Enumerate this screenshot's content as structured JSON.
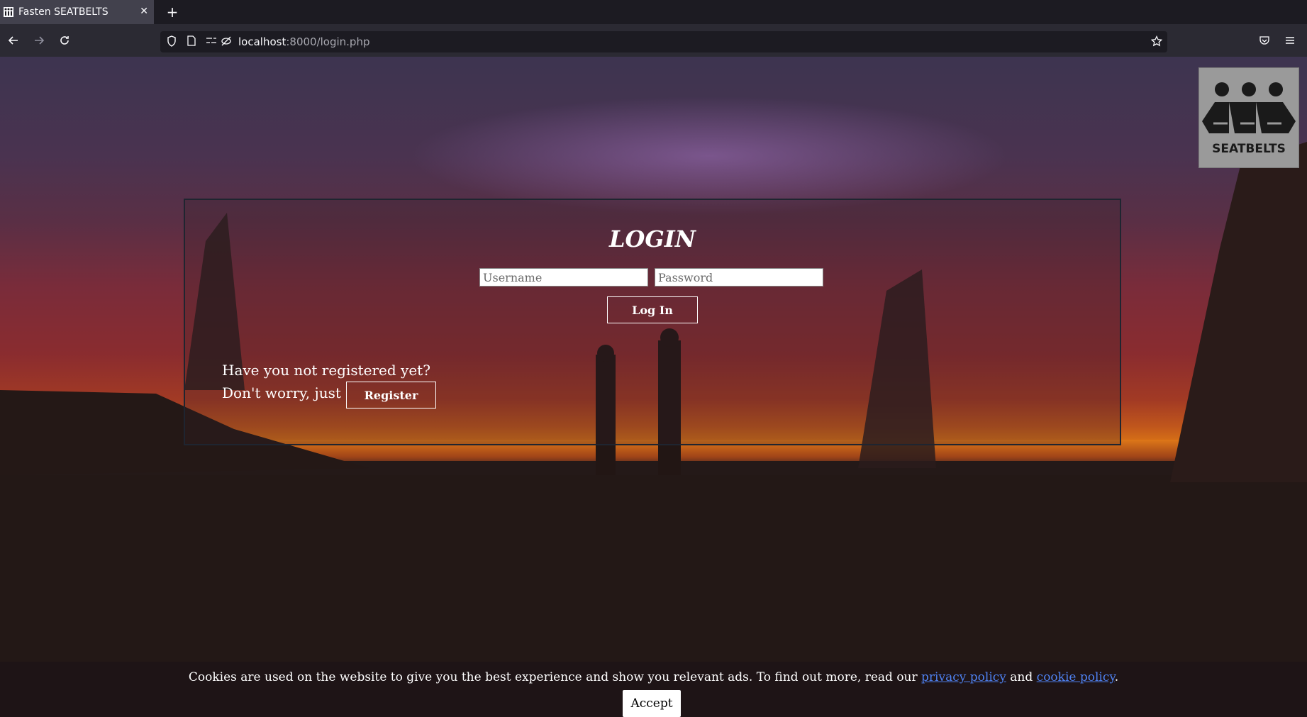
{
  "browser": {
    "tab_title": "Fasten SEATBELTS",
    "new_tab_label": "+",
    "close_tab_label": "✕",
    "url_host": "localhost",
    "url_path": ":8000/login.php"
  },
  "login": {
    "title": "LOGIN",
    "username_placeholder": "Username",
    "password_placeholder": "Password",
    "login_button": "Log In"
  },
  "register": {
    "line1": "Have you not registered yet?",
    "line2": "Don't worry, just",
    "register_button": "Register"
  },
  "logo": {
    "text": "SEATBELTS"
  },
  "cookie": {
    "text_before": "Cookies are used on the website to give you the best experience and show you relevant ads. To find out more, read our ",
    "privacy_link": "privacy policy",
    "text_middle": " and ",
    "cookie_link": "cookie policy",
    "text_after": ".",
    "accept_button": "Accept"
  },
  "colors": {
    "link": "#4f82f2",
    "browser_bg": "#1c1b22",
    "tab_active": "#42414d"
  }
}
